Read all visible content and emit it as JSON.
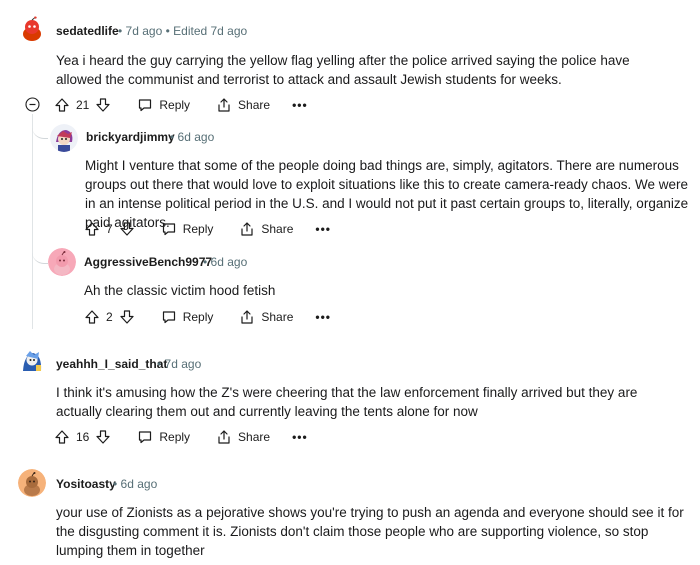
{
  "comments": [
    {
      "username": "sedatedlife",
      "time": "7d ago",
      "edited": "Edited 7d ago",
      "body": "Yea i heard the guy carrying the yellow flag yelling after the police arrived saying the police have allowed the communist and terrorist to attack and assault Jewish students for weeks.",
      "votes": "21",
      "reply_label": "Reply",
      "share_label": "Share",
      "more_label": "•••",
      "replies": [
        {
          "username": "brickyardjimmy",
          "time": "6d ago",
          "body": "Might I venture that some of the people doing bad things are, simply, agitators. There are numerous groups out there that would love to exploit situations like this to create camera-ready chaos. We were in an intense political period in the U.S. and I would not put it past certain groups to, literally, organize paid agitators.",
          "votes": "7",
          "reply_label": "Reply",
          "share_label": "Share",
          "more_label": "•••"
        },
        {
          "username": "AggressiveBench9977",
          "time": "6d ago",
          "body": "Ah the classic victim hood fetish",
          "votes": "2",
          "reply_label": "Reply",
          "share_label": "Share",
          "more_label": "•••"
        }
      ]
    },
    {
      "username": "yeahhh_I_said_that",
      "time": "7d ago",
      "body": "I think it's amusing how the Z's were cheering that the law enforcement finally arrived but they are actually clearing them out and currently leaving the tents alone for now",
      "votes": "16",
      "reply_label": "Reply",
      "share_label": "Share",
      "more_label": "•••"
    },
    {
      "username": "Yositoasty",
      "time": "6d ago",
      "body": "your use of Zionists as a pejorative shows you're trying to push an agenda and everyone should see it for the disgusting comment it is. Zionists don't claim those people who are supporting violence, so stop lumping them in together"
    }
  ],
  "separator": "•",
  "colors": {
    "text": "#1a1a1b",
    "meta": "#576f76",
    "thread_line": "#e0e4e6",
    "snoo_red": "#d93a00",
    "snoo_orange": "#f4a261"
  }
}
